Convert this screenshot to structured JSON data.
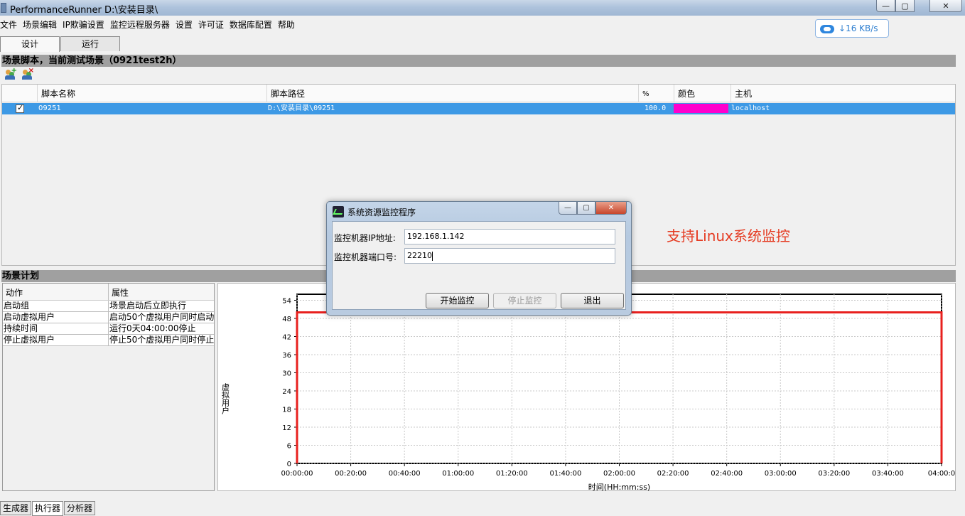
{
  "window": {
    "title": "PerformanceRunner  D:\\安装目录\\",
    "minimize": "—",
    "maximize": "▢",
    "close": "✕"
  },
  "menu": [
    "文件",
    "场景编辑",
    "IP欺骗设置",
    "监控远程服务器",
    "设置",
    "许可证",
    "数据库配置",
    "帮助"
  ],
  "net_speed": "↓16 KB/s",
  "tabs": {
    "design": "设计",
    "run": "运行"
  },
  "scenario_header": "场景脚本，当前测试场景（0921test2h）",
  "toolbar_icons": [
    "add-user-icon",
    "remove-user-icon"
  ],
  "script_table": {
    "columns": [
      "脚本名称",
      "脚本路径",
      "%",
      "颜色",
      "主机"
    ],
    "rows": [
      {
        "checked": true,
        "name": "09251",
        "path": "D:\\安装目录\\09251",
        "percent": "100.0",
        "color": "#ff00cc",
        "host": "localhost"
      }
    ]
  },
  "plan_header": "场景计划",
  "plan_table": {
    "columns": [
      "动作",
      "属性"
    ],
    "rows": [
      [
        "启动组",
        "场景启动后立即执行"
      ],
      [
        "启动虚拟用户",
        "启动50个虚拟用户同时启动"
      ],
      [
        "持续时间",
        "运行0天04:00:00停止"
      ],
      [
        "停止虚拟用户",
        "停止50个虚拟用户同时停止"
      ]
    ]
  },
  "chart_data": {
    "type": "line",
    "ylabel": "虚拟用户",
    "xlabel": "时间(HH:mm:ss)",
    "y_ticks": [
      0,
      6,
      12,
      18,
      24,
      30,
      36,
      42,
      48,
      54
    ],
    "x_ticks": [
      "00:00:00",
      "00:20:00",
      "00:40:00",
      "01:00:00",
      "01:20:00",
      "01:40:00",
      "02:00:00",
      "02:20:00",
      "02:40:00",
      "03:00:00",
      "03:20:00",
      "03:40:00",
      "04:00:0"
    ],
    "ylim": [
      0,
      56
    ],
    "xlim_minutes": [
      0,
      240
    ],
    "series": [
      {
        "color": "#e8201e",
        "x_minutes": [
          0,
          0,
          240,
          240
        ],
        "values": [
          0,
          50,
          50,
          0
        ]
      }
    ],
    "grid": true
  },
  "bottom_tabs": [
    "生成器",
    "执行器",
    "分析器"
  ],
  "dialog": {
    "title": "系统资源监控程序",
    "ip_label": "监控机器IP地址:",
    "ip_value": "192.168.1.142",
    "port_label": "监控机器端口号:",
    "port_value": "22210",
    "start_button": "开始监控",
    "stop_button": "停止监控",
    "exit_button": "退出",
    "min": "—",
    "max": "▢",
    "close": "✕"
  },
  "annotation": "支持Linux系统监控"
}
